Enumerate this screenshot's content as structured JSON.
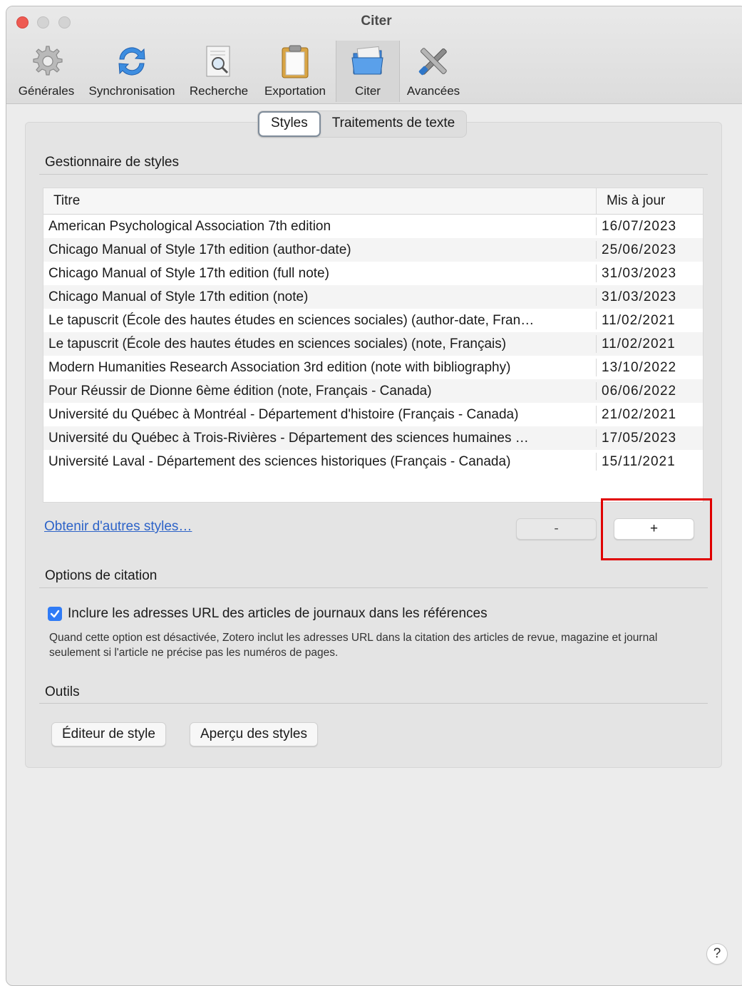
{
  "window": {
    "title": "Citer"
  },
  "toolbar": {
    "items": [
      {
        "label": "Générales",
        "icon": "gear-icon"
      },
      {
        "label": "Synchronisation",
        "icon": "sync-icon"
      },
      {
        "label": "Recherche",
        "icon": "search-document-icon"
      },
      {
        "label": "Exportation",
        "icon": "clipboard-icon"
      },
      {
        "label": "Citer",
        "icon": "folder-icon"
      },
      {
        "label": "Avancées",
        "icon": "tools-icon"
      }
    ],
    "active": "Citer"
  },
  "tabs": {
    "styles": "Styles",
    "word": "Traitements de texte",
    "selected": "Styles"
  },
  "style_manager": {
    "title": "Gestionnaire de styles",
    "columns": {
      "title": "Titre",
      "updated": "Mis à jour"
    },
    "rows": [
      {
        "title": "American Psychological Association 7th edition",
        "date": "16/07/2023"
      },
      {
        "title": "Chicago Manual of Style 17th edition (author-date)",
        "date": "25/06/2023"
      },
      {
        "title": "Chicago Manual of Style 17th edition (full note)",
        "date": "31/03/2023"
      },
      {
        "title": "Chicago Manual of Style 17th edition (note)",
        "date": "31/03/2023"
      },
      {
        "title": "Le tapuscrit (École des hautes études en sciences sociales) (author-date, Fran…",
        "date": "11/02/2021"
      },
      {
        "title": "Le tapuscrit (École des hautes études en sciences sociales) (note, Français)",
        "date": "11/02/2021"
      },
      {
        "title": "Modern Humanities Research Association 3rd edition (note with bibliography)",
        "date": "13/10/2022"
      },
      {
        "title": "Pour Réussir de Dionne 6ème édition (note, Français - Canada)",
        "date": "06/06/2022"
      },
      {
        "title": "Université du Québec à Montréal - Département d'histoire (Français - Canada)",
        "date": "21/02/2021"
      },
      {
        "title": "Université du Québec à Trois-Rivières - Département des sciences humaines …",
        "date": "17/05/2023"
      },
      {
        "title": "Université Laval - Département des sciences historiques (Français - Canada)",
        "date": "15/11/2021"
      }
    ],
    "get_more_link": "Obtenir d'autres styles…",
    "remove_label": "-",
    "add_label": "+"
  },
  "citation_options": {
    "title": "Options de citation",
    "include_urls_label": "Inclure les adresses URL des articles de journaux dans les références",
    "include_urls_checked": true,
    "help_text": "Quand cette option est désactivée, Zotero inclut les adresses URL dans la citation des articles de revue, magazine et journal seulement si l'article ne précise pas les numéros de pages."
  },
  "tools": {
    "title": "Outils",
    "style_editor": "Éditeur de style",
    "style_preview": "Aperçu des styles"
  },
  "help_button": "?",
  "colors": {
    "accent": "#2f7bf6",
    "link": "#2d63c8",
    "highlight": "#e00000"
  }
}
